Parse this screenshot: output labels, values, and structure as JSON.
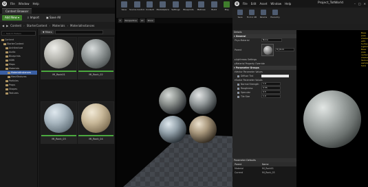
{
  "colors": {
    "accent_green": "#4caa3f",
    "selection_blue": "#3a5fa3",
    "stats_yellow": "#e0c020"
  },
  "browser": {
    "menu": [
      "File",
      "Window",
      "Help"
    ],
    "tab": "Content Browser",
    "add_new": "Add New",
    "import": "Import",
    "save_all": "Save All",
    "breadcrumb": [
      "Content",
      "StarterContent",
      "Materials",
      "MaterialInstances"
    ],
    "search_placeholder": "Search Folders",
    "filters": "Filters",
    "tree": [
      "Content",
      "StarterContent",
      "Architecture",
      "Audio",
      "Blueprints",
      "HDRI",
      "Maps",
      "Materials",
      "MaterialInstances",
      "MeshTextures",
      "Particles",
      "Props",
      "Shapes",
      "Textures"
    ],
    "assets": [
      {
        "name": "MI_Rock01"
      },
      {
        "name": "MI_Rock_02"
      },
      {
        "name": "MI_Rock_03"
      },
      {
        "name": "MI_Rock_04"
      }
    ]
  },
  "viewport": {
    "toolbar": [
      "Save",
      "Source Control",
      "Content",
      "Marketplace",
      "Settings",
      "Blueprints",
      "Matinee",
      "Build",
      "Play"
    ],
    "mode": "Perspective",
    "lit": "Lit",
    "show": "Show"
  },
  "editor": {
    "menu": [
      "File",
      "Edit",
      "Asset",
      "Window",
      "Help"
    ],
    "title": "Project_TotWorld",
    "toolbar": [
      "Save",
      "Find in CB",
      "Params",
      "Hierarchy"
    ],
    "stats": [
      "Base pass shader with Surface Lightmap",
      "Base pass vertex shader",
      "Texture samplers: 5/16"
    ],
    "details_header": "Details",
    "general_cat": "General",
    "phys_material": "Phys Material",
    "phys_value": "None",
    "parent_label": "Parent",
    "parent_value": "M_Rock",
    "lightmass": "Lightmass Settings",
    "mat_prop": "Material Property Override",
    "param_groups": "Parameter Groups",
    "vector_params": "Vector Parameter Values",
    "diffuse_tint": "Diffuse Tint",
    "scalar_params": "Scalar Parameter Values",
    "scalars": [
      {
        "name": "Normal Strength",
        "value": "1.0"
      },
      {
        "name": "Roughness",
        "value": "0.55"
      },
      {
        "name": "Specular",
        "value": "0.5"
      },
      {
        "name": "Tile Size",
        "value": "1.0"
      }
    ],
    "grid_header": "Parameter Defaults",
    "grid_cols": [
      "Parent",
      "Name"
    ],
    "grid_rows": [
      [
        "Material",
        "MI_Rock01"
      ],
      [
        "Current",
        "MI_Rock_03"
      ]
    ]
  }
}
